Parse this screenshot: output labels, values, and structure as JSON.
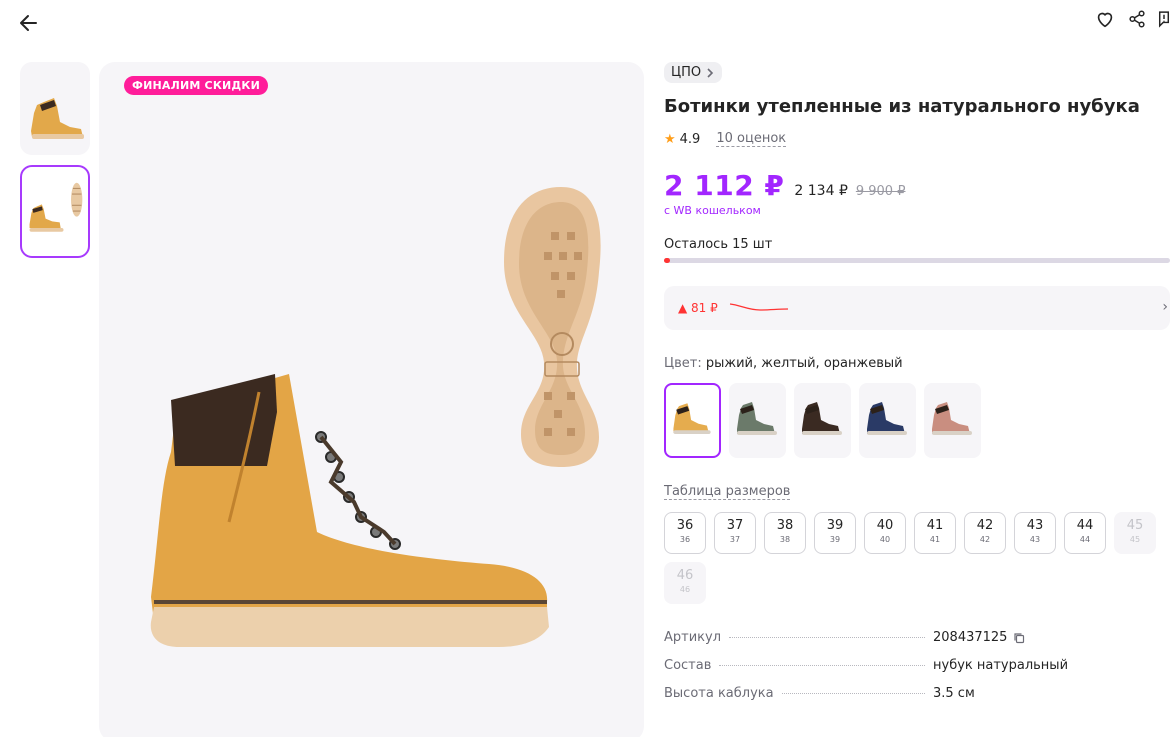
{
  "header": {
    "back_icon": "arrow-left-icon",
    "actions": [
      "heart-icon",
      "share-icon",
      "report-icon"
    ]
  },
  "gallery": {
    "promo_badge": "ФИНАЛИМ СКИДКИ",
    "thumbnails": [
      "boot-side-view",
      "boot-with-sole-view"
    ],
    "active_thumbnail": 1
  },
  "product": {
    "brand": "ЦПО",
    "title": "Ботинки утепленные из натурального нубука",
    "rating": "4.9",
    "reviews": "10 оценок",
    "price_wallet": "2 112 ₽",
    "price_regular": "2 134 ₽",
    "price_old": "9 900 ₽",
    "wallet_note": "с WB кошельком",
    "stock_text": "Осталось 15 шт",
    "stock_fraction": 0.01,
    "price_change": "▲ 81 ₽",
    "color_label": "Цвет:",
    "color_value": "рыжий, желтый, оранжевый",
    "color_swatches": [
      {
        "name": "yellow",
        "color": "#e5ac4e"
      },
      {
        "name": "grey-green",
        "color": "#6b7a6a"
      },
      {
        "name": "black",
        "color": "#3a2a22"
      },
      {
        "name": "navy",
        "color": "#2a3a66"
      },
      {
        "name": "pink",
        "color": "#c98e80"
      }
    ],
    "size_table_link": "Таблица размеров",
    "sizes": [
      {
        "n": "36",
        "r": "36",
        "available": true
      },
      {
        "n": "37",
        "r": "37",
        "available": true
      },
      {
        "n": "38",
        "r": "38",
        "available": true
      },
      {
        "n": "39",
        "r": "39",
        "available": true
      },
      {
        "n": "40",
        "r": "40",
        "available": true
      },
      {
        "n": "41",
        "r": "41",
        "available": true
      },
      {
        "n": "42",
        "r": "42",
        "available": true
      },
      {
        "n": "43",
        "r": "43",
        "available": true
      },
      {
        "n": "44",
        "r": "44",
        "available": true
      },
      {
        "n": "45",
        "r": "45",
        "available": false
      },
      {
        "n": "46",
        "r": "46",
        "available": false
      }
    ],
    "specs": [
      {
        "k": "Артикул",
        "v": "208437125",
        "copy": true
      },
      {
        "k": "Состав",
        "v": "нубук натуральный",
        "copy": false
      },
      {
        "k": "Высота каблука",
        "v": "3.5 см",
        "copy": false
      }
    ]
  },
  "colors": {
    "accent": "#a226ff",
    "promo": "#ff1d9a",
    "danger": "#ff3333",
    "boot": "#e5ac4e"
  }
}
